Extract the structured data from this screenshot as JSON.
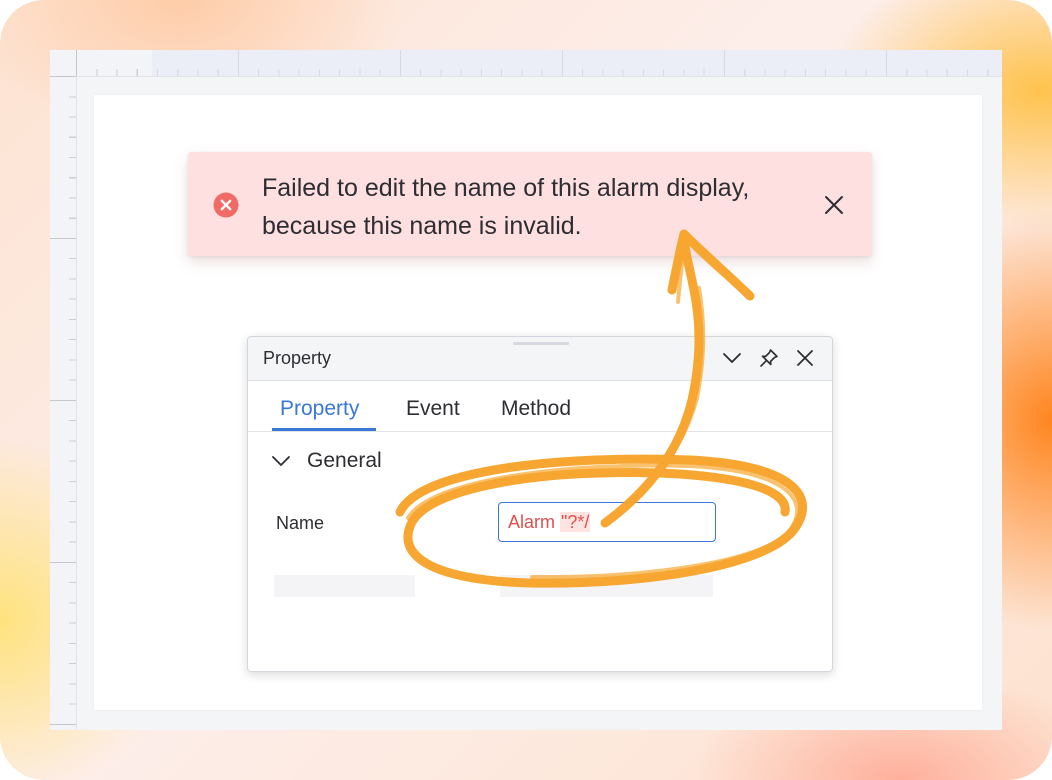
{
  "toast": {
    "message": "Failed to edit the name of this alarm display, because this name is invalid.",
    "icon": "error-circle-icon",
    "close_icon": "close-icon",
    "color": "#fde0df",
    "icon_color": "#f06a66"
  },
  "panel": {
    "title": "Property",
    "header_icons": [
      "chevron-down-icon",
      "pin-icon",
      "close-icon"
    ],
    "tabs": [
      {
        "label": "Property",
        "active": true
      },
      {
        "label": "Event",
        "active": false
      },
      {
        "label": "Method",
        "active": false
      }
    ],
    "section": {
      "label": "General",
      "expanded": true
    },
    "fields": [
      {
        "label": "Name",
        "value_valid": "Alarm ",
        "value_invalid": "\"?*/"
      }
    ]
  },
  "colors": {
    "accent": "#3a78d8",
    "error_text": "#e0514d",
    "annotation": "#f7a326"
  }
}
